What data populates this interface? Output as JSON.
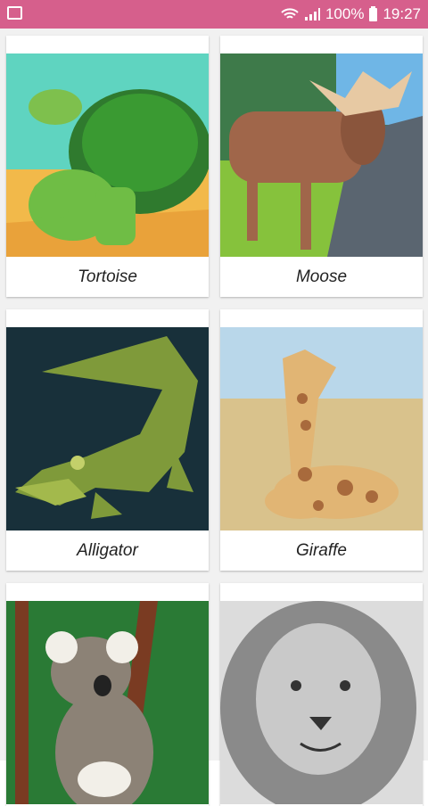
{
  "status_bar": {
    "battery": "100%",
    "time": "19:27",
    "icons": [
      "gallery-icon",
      "wifi-icon",
      "signal-icon",
      "battery-icon"
    ]
  },
  "animals": [
    {
      "name": "Tortoise"
    },
    {
      "name": "Moose"
    },
    {
      "name": "Alligator"
    },
    {
      "name": "Giraffe"
    },
    {
      "name": ""
    },
    {
      "name": ""
    }
  ],
  "colors": {
    "status_bar": "#d65f8c",
    "background": "#f1f1f1",
    "card": "#ffffff"
  }
}
